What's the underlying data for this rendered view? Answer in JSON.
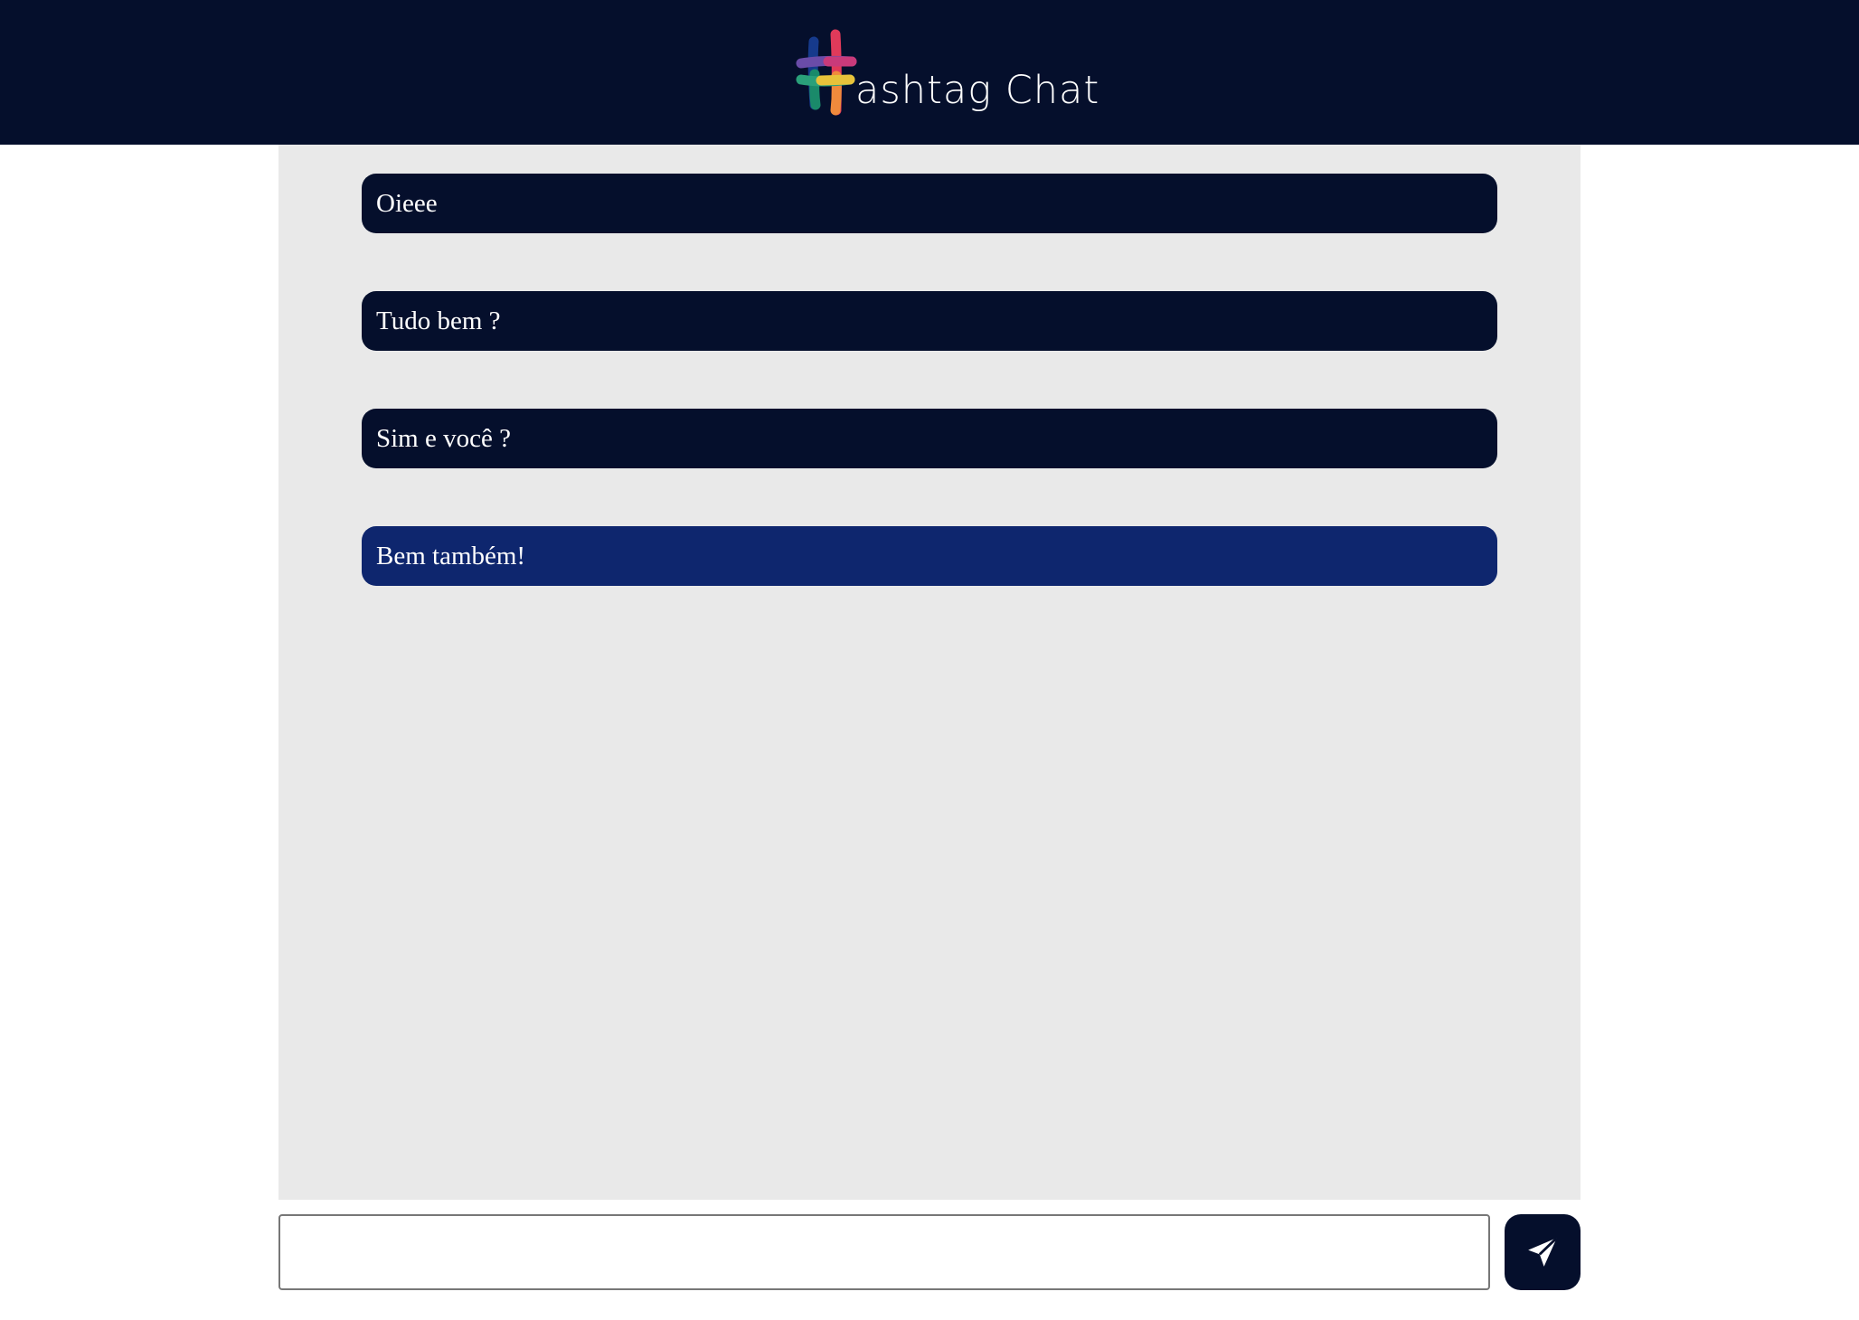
{
  "header": {
    "logo_text": "ashtag Chat",
    "logo_icon": "hashtag-icon",
    "background": "#050f2c"
  },
  "chat": {
    "background": "#e9e9e9",
    "messages": [
      {
        "text": "Oieee",
        "own": false
      },
      {
        "text": "Tudo bem ?",
        "own": false
      },
      {
        "text": "Sim e você ?",
        "own": false
      },
      {
        "text": "Bem também!",
        "own": true
      }
    ]
  },
  "composer": {
    "input_value": "",
    "placeholder": "",
    "send_icon": "send-icon"
  },
  "colors": {
    "message_bg": "#050f2c",
    "own_message_bg": "#0e266e",
    "text": "#ffffff"
  }
}
